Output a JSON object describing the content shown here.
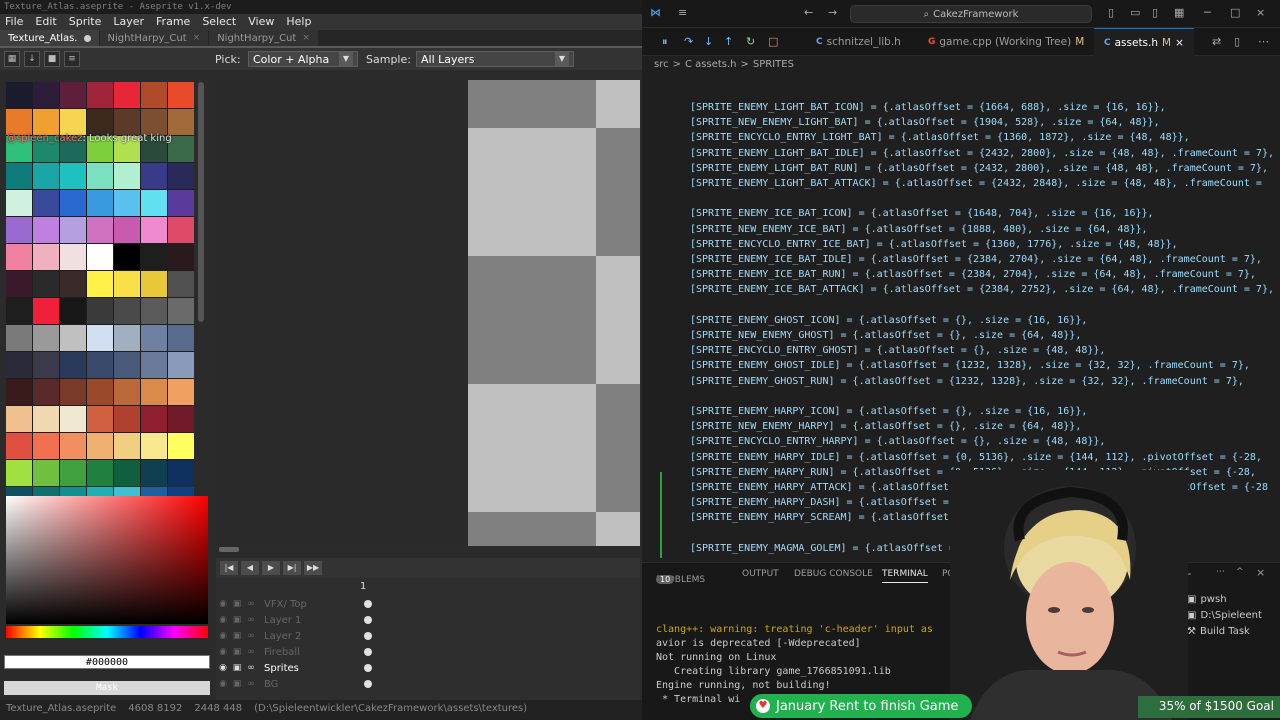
{
  "aseprite": {
    "title": "Texture_Atlas.aseprite - Aseprite v1.x-dev",
    "menu": [
      "File",
      "Edit",
      "Sprite",
      "Layer",
      "Frame",
      "Select",
      "View",
      "Help"
    ],
    "tabs": [
      "Texture_Atlas.",
      "NightHarpy_Cut",
      "NightHarpy_Cut"
    ],
    "toolbar": {
      "pick_label": "Pick:",
      "pick_value": "Color + Alpha",
      "sample_label": "Sample:",
      "sample_value": "All Layers"
    },
    "palette_chat": {
      "user": "@spleen_cakez",
      "text": ": Looks great king"
    },
    "palette": [
      "#1b1b2e",
      "#2e1d3a",
      "#5e1f3c",
      "#a0243a",
      "#e8263a",
      "#b04a2a",
      "#e84a2a",
      "#e87a2a",
      "#f0a030",
      "#f6d650",
      "#3a2a1e",
      "#5c3a2a",
      "#7a5030",
      "#a06a3a",
      "#2ec07a",
      "#1a8a6a",
      "#1e6a5a",
      "#7ed03a",
      "#b0e050",
      "#2a4a3a",
      "#3a6a4a",
      "#0e7a7a",
      "#1aa6a6",
      "#1ec0c0",
      "#7ae0c0",
      "#b0f0d0",
      "#3a3a8a",
      "#2a2a5a",
      "#d0f0e0",
      "#3a4a9a",
      "#2a6ad0",
      "#3a9ae0",
      "#5ac0f0",
      "#60e0f0",
      "#5a3a9a",
      "#9a6ad0",
      "#c080e0",
      "#b4a0e0",
      "#d070c0",
      "#c85ab0",
      "#f08ad0",
      "#e04a6a",
      "#f080a0",
      "#f0b0c0",
      "#f0e0e0",
      "#ffffff",
      "#000000",
      "#1e1e1e",
      "#2a1a1e",
      "#3a1a2a",
      "#2a2a2a",
      "#3a2a2a",
      "#fff048",
      "#f8e048",
      "#e8c838",
      "#505050",
      "#1e1e1e",
      "#f0203a",
      "#181818",
      "#3a3a3a",
      "#4a4a4a",
      "#5a5a5a",
      "#6a6a6a",
      "#7a7a7a",
      "#9a9a9a",
      "#c0c0c0",
      "#d0e0f0",
      "#a0b0c0",
      "#7080a0",
      "#5a6a8a",
      "#2a2a3a",
      "#3a3a4a",
      "#2a3a5a",
      "#3a4a6a",
      "#4a5a7a",
      "#6a7a9a",
      "#8a9aba",
      "#3a1a1a",
      "#5a2a2a",
      "#7a3a2a",
      "#9a4a2a",
      "#ba6a3a",
      "#da8a4a",
      "#f0a060",
      "#f0c090",
      "#f0d8b0",
      "#f0e8d0",
      "#d06040",
      "#b04030",
      "#902030",
      "#701a2a",
      "#e05040",
      "#f07050",
      "#f09060",
      "#f0b070",
      "#f0d080",
      "#f8e890",
      "#ffff60",
      "#a0e040",
      "#70c040",
      "#40a040",
      "#208040",
      "#106040",
      "#104050",
      "#103060",
      "#105060",
      "#107070",
      "#109090",
      "#20b0b0",
      "#40c0d0",
      "#2060a0",
      "#104080",
      "#3ad070",
      "#30a060",
      "#208050",
      "#f0c020",
      "#f0e040",
      "#a0e050",
      "#60c060"
    ],
    "hex_value": "#000000",
    "mask_label": "Mask",
    "layers": [
      {
        "name": "VFX/ Top",
        "active": false
      },
      {
        "name": "Layer 1",
        "active": false
      },
      {
        "name": "Layer 2",
        "active": false
      },
      {
        "name": "Fireball",
        "active": false
      },
      {
        "name": "Sprites",
        "active": true
      },
      {
        "name": "BG",
        "active": false
      }
    ],
    "frame_number": "1",
    "status": [
      "Texture_Atlas.aseprite",
      "4608 8192",
      "2448 448",
      "(D:\\Spieleentwickler\\CakezFramework\\assets\\textures)"
    ]
  },
  "vscode": {
    "search_text": "CakezFramework",
    "tabs": [
      {
        "lang": "C",
        "name": "schnitzel_lib.h",
        "modified": "",
        "active": false
      },
      {
        "lang": "G",
        "name": "game.cpp (Working Tree)",
        "modified": "M",
        "active": false
      },
      {
        "lang": "C",
        "name": "assets.h",
        "modified": "M",
        "active": true
      }
    ],
    "breadcrumb": [
      "src",
      ">",
      "C assets.h",
      ">",
      "SPRITES"
    ],
    "code_lines": [
      "[SPRITE_ENEMY_LIGHT_BAT_ICON] = {.atlasOffset = {1664, 688}, .size = {16, 16}},",
      "[SPRITE_NEW_ENEMY_LIGHT_BAT] = {.atlasOffset = {1904, 528}, .size = {64, 48}},",
      "[SPRITE_ENCYCLO_ENTRY_LIGHT_BAT] = {.atlasOffset = {1360, 1872}, .size = {48, 48}},",
      "[SPRITE_ENEMY_LIGHT_BAT_IDLE] = {.atlasOffset = {2432, 2800}, .size = {48, 48}, .frameCount = 7},",
      "[SPRITE_ENEMY_LIGHT_BAT_RUN] = {.atlasOffset = {2432, 2800}, .size = {48, 48}, .frameCount = 7},",
      "[SPRITE_ENEMY_LIGHT_BAT_ATTACK] = {.atlasOffset = {2432, 2848}, .size = {48, 48}, .frameCount =",
      "",
      "[SPRITE_ENEMY_ICE_BAT_ICON] = {.atlasOffset = {1648, 704}, .size = {16, 16}},",
      "[SPRITE_NEW_ENEMY_ICE_BAT] = {.atlasOffset = {1888, 480}, .size = {64, 48}},",
      "[SPRITE_ENCYCLO_ENTRY_ICE_BAT] = {.atlasOffset = {1360, 1776}, .size = {48, 48}},",
      "[SPRITE_ENEMY_ICE_BAT_IDLE] = {.atlasOffset = {2384, 2704}, .size = {64, 48}, .frameCount = 7},",
      "[SPRITE_ENEMY_ICE_BAT_RUN] = {.atlasOffset = {2384, 2704}, .size = {64, 48}, .frameCount = 7},",
      "[SPRITE_ENEMY_ICE_BAT_ATTACK] = {.atlasOffset = {2384, 2752}, .size = {64, 48}, .frameCount = 7},",
      "",
      "[SPRITE_ENEMY_GHOST_ICON] = {.atlasOffset = {}, .size = {16, 16}},",
      "[SPRITE_NEW_ENEMY_GHOST] = {.atlasOffset = {}, .size = {64, 48}},",
      "[SPRITE_ENCYCLO_ENTRY_GHOST] = {.atlasOffset = {}, .size = {48, 48}},",
      "[SPRITE_ENEMY_GHOST_IDLE] = {.atlasOffset = {1232, 1328}, .size = {32, 32}, .frameCount = 7},",
      "[SPRITE_ENEMY_GHOST_RUN] = {.atlasOffset = {1232, 1328}, .size = {32, 32}, .frameCount = 7},",
      "",
      "[SPRITE_ENEMY_HARPY_ICON] = {.atlasOffset = {}, .size = {16, 16}},",
      "[SPRITE_NEW_ENEMY_HARPY] = {.atlasOffset = {}, .size = {64, 48}},",
      "[SPRITE_ENCYCLO_ENTRY_HARPY] = {.atlasOffset = {}, .size = {48, 48}},",
      "[SPRITE_ENEMY_HARPY_IDLE] = {.atlasOffset = {0, 5136}, .size = {144, 112}, .pivotOffset = {-28,",
      "[SPRITE_ENEMY_HARPY_RUN] = {.atlasOffset = {0, 5136}, .size = {144, 112}, .pivotOffset = {-28,",
      "[SPRITE_ENEMY_HARPY_ATTACK] = {.atlasOffset = {0, 5360}, .size = {144, 112}, .pivotOffset = {-28",
      "[SPRITE_ENEMY_HARPY_DASH] = {.atlasOffset = {0, 5",
      "[SPRITE_ENEMY_HARPY_SCREAM] = {.atlasOffset =",
      "",
      "[SPRITE_ENEMY_MAGMA_GOLEM] = {.atlasOffset ="
    ],
    "panel_tabs": {
      "problems": "PROBLEMS",
      "problems_count": "10",
      "output": "OUTPUT",
      "debug": "DEBUG CONSOLE",
      "terminal": "TERMINAL",
      "ports": "PO"
    },
    "terminal_lines": [
      "clang++: warning: treating 'c-header' input as",
      "avior is deprecated [-Wdeprecated]",
      "Not running on Linux",
      "   Creating library game_1766851091.lib",
      "Engine running, not building!",
      " * Terminal wi"
    ],
    "terminal_list": [
      "pwsh",
      "D:\\Spieleent",
      "Build  Task"
    ]
  },
  "overlay": {
    "donation_text": "January Rent to finish Game",
    "goal_text": "35% of $1500 Goal"
  }
}
